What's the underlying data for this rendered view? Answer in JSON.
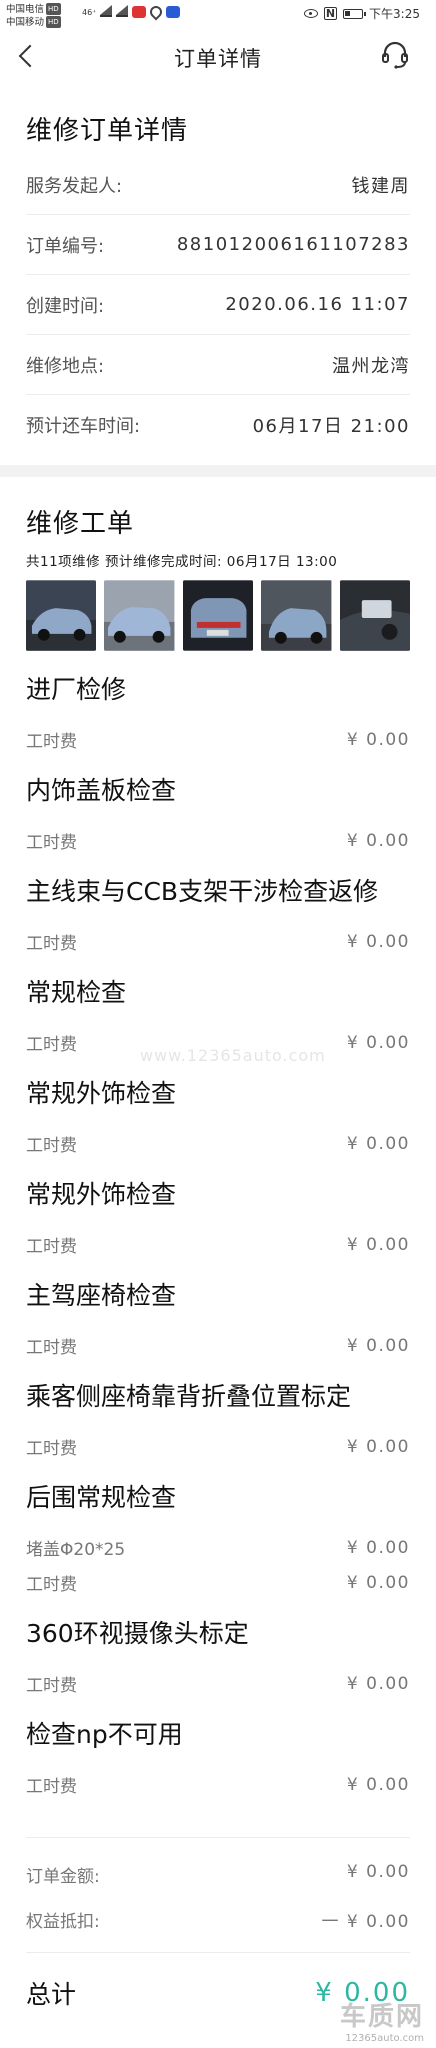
{
  "status_bar": {
    "carrier1": "中国电信",
    "carrier2": "中国移动",
    "hd": "HD",
    "net1": "46⁺",
    "time": "下午3:25"
  },
  "nav": {
    "title": "订单详情"
  },
  "repair_order": {
    "title": "维修订单详情",
    "rows": [
      {
        "label": "服务发起人:",
        "value": "钱建周"
      },
      {
        "label": "订单编号:",
        "value": "881012006161107283"
      },
      {
        "label": "创建时间:",
        "value": "2020.06.16 11:07"
      },
      {
        "label": "维修地点:",
        "value": "温州龙湾"
      },
      {
        "label": "预计还车时间:",
        "value": "06月17日 21:00"
      }
    ]
  },
  "work_order": {
    "title": "维修工单",
    "summary": "共11项维修  预计维修完成时间: 06月17日 13:00",
    "photos": [
      "car-photo-1",
      "car-photo-2",
      "car-photo-3",
      "car-photo-4",
      "car-photo-5"
    ],
    "items": [
      {
        "title": "进厂检修",
        "fees": [
          {
            "label": "工时费",
            "amount": "¥ 0.00"
          }
        ]
      },
      {
        "title": "内饰盖板检查",
        "fees": [
          {
            "label": "工时费",
            "amount": "¥ 0.00"
          }
        ]
      },
      {
        "title": "主线束与CCB支架干涉检查返修",
        "fees": [
          {
            "label": "工时费",
            "amount": "¥ 0.00"
          }
        ]
      },
      {
        "title": "常规检查",
        "fees": [
          {
            "label": "工时费",
            "amount": "¥ 0.00"
          }
        ]
      },
      {
        "title": "常规外饰检查",
        "fees": [
          {
            "label": "工时费",
            "amount": "¥ 0.00"
          }
        ]
      },
      {
        "title": "常规外饰检查",
        "fees": [
          {
            "label": "工时费",
            "amount": "¥ 0.00"
          }
        ]
      },
      {
        "title": "主驾座椅检查",
        "fees": [
          {
            "label": "工时费",
            "amount": "¥ 0.00"
          }
        ]
      },
      {
        "title": "乘客侧座椅靠背折叠位置标定",
        "fees": [
          {
            "label": "工时费",
            "amount": "¥ 0.00"
          }
        ]
      },
      {
        "title": "后围常规检查",
        "fees": [
          {
            "label": "堵盖Φ20*25",
            "amount": "¥ 0.00"
          },
          {
            "label": "工时费",
            "amount": "¥ 0.00"
          }
        ]
      },
      {
        "title": "360环视摄像头标定",
        "fees": [
          {
            "label": "工时费",
            "amount": "¥ 0.00"
          }
        ]
      },
      {
        "title": "检查np不可用",
        "fees": [
          {
            "label": "工时费",
            "amount": "¥ 0.00"
          }
        ]
      }
    ]
  },
  "totals": {
    "order_amount_label": "订单金额:",
    "order_amount": "¥ 0.00",
    "discount_label": "权益抵扣:",
    "discount": "一 ¥ 0.00",
    "total_label": "总计",
    "total": "¥ 0.00"
  },
  "watermark": "www.12365auto.com",
  "logo": {
    "main": "车质网",
    "sub": "12365auto.com"
  },
  "colors": {
    "accent": "#2bb7a2",
    "band": "#f2f2f2",
    "text": "#222222"
  }
}
